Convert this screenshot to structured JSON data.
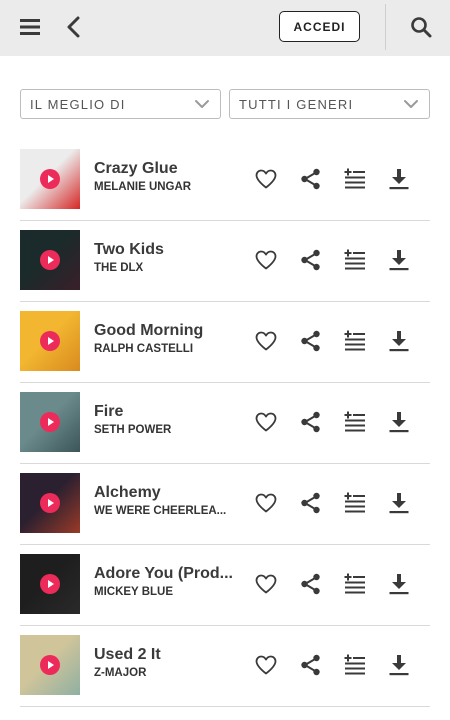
{
  "header": {
    "menu_icon": "hamburger-menu-icon",
    "back_icon": "chevron-left-icon",
    "login_label": "ACCEDI",
    "search_icon": "search-icon"
  },
  "filters": [
    {
      "label": "IL MEGLIO DI",
      "icon": "chevron-down-icon"
    },
    {
      "label": "TUTTI I GENERI",
      "icon": "chevron-down-icon"
    }
  ],
  "colors": {
    "play_button": "#ec2b5a",
    "header_bg": "#ebebeb",
    "icon": "#3a3a3a"
  },
  "tracks": [
    {
      "title": "Crazy Glue",
      "artist": "MELANIE UNGAR",
      "art": [
        "#ececec",
        "#d62626"
      ]
    },
    {
      "title": "Two Kids",
      "artist": "THE DLX",
      "art": [
        "#1b2a2a",
        "#3a1f2a"
      ]
    },
    {
      "title": "Good Morning",
      "artist": "RALPH CASTELLI",
      "art": [
        "#f2b630",
        "#d98a1f"
      ]
    },
    {
      "title": "Fire",
      "artist": "SETH POWER",
      "art": [
        "#6b8a8c",
        "#3c5558"
      ]
    },
    {
      "title": "Alchemy",
      "artist": "WE WERE CHEERLEA...",
      "art": [
        "#2b2030",
        "#9a3a28"
      ]
    },
    {
      "title": "Adore You (Prod...",
      "artist": "MICKEY BLUE",
      "art": [
        "#1e1e1e",
        "#2a2a2a"
      ]
    },
    {
      "title": "Used 2 It",
      "artist": "Z-MAJOR",
      "art": [
        "#cfc49a",
        "#8fb0a2"
      ]
    }
  ],
  "track_actions": [
    "heart-icon",
    "share-icon",
    "add-to-queue-icon",
    "download-icon"
  ]
}
